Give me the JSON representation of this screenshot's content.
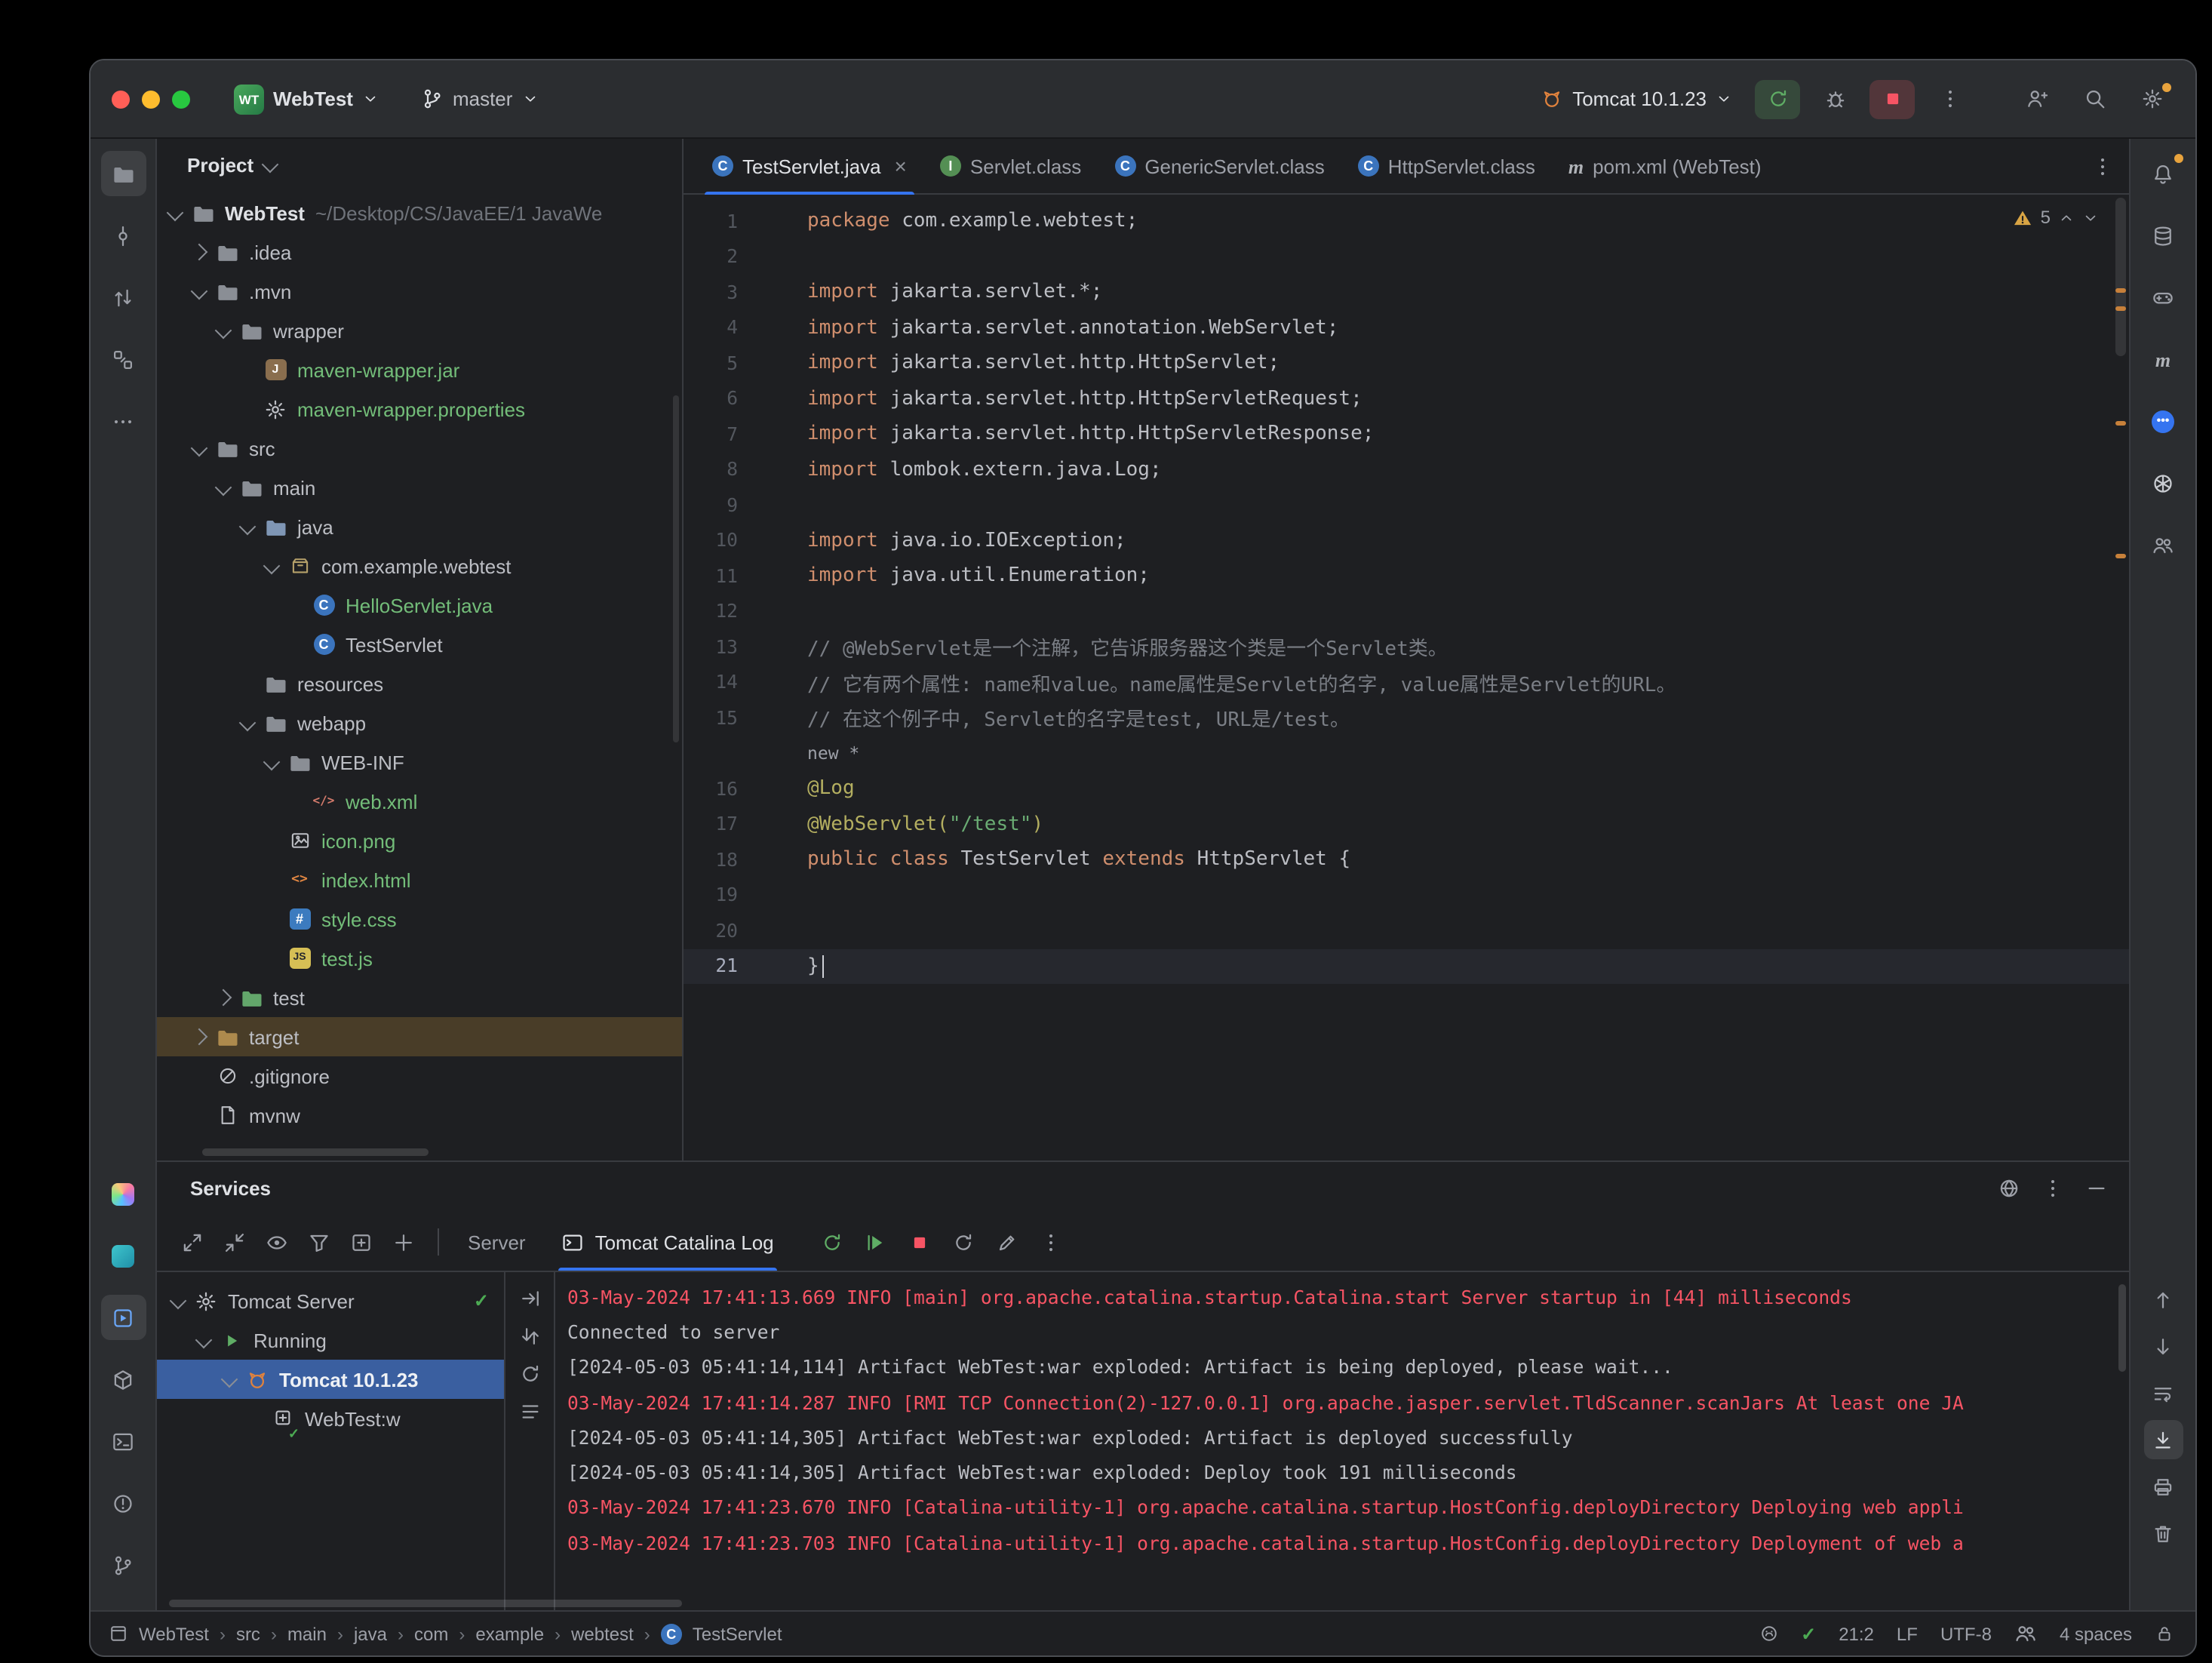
{
  "titlebar": {
    "project_logo": "WT",
    "project_name": "WebTest",
    "branch_name": "master",
    "run_config_name": "Tomcat 10.1.23",
    "action_icons": [
      "run-icon",
      "debug-icon",
      "stop-icon",
      "kebab-icon"
    ],
    "tool_icons": [
      "add-user-icon",
      "search-icon",
      "settings-icon"
    ]
  },
  "left_strip": {
    "top": [
      {
        "icon": "project-folder-icon",
        "selected": true
      },
      {
        "icon": "commit-icon"
      },
      {
        "icon": "pull-requests-icon"
      },
      {
        "icon": "structure-icon"
      },
      {
        "icon": "more-tools-icon"
      }
    ],
    "bottom": [
      {
        "icon": "ai-assistant-icon"
      },
      {
        "icon": "code-with-me-icon"
      },
      {
        "icon": "services-icon",
        "selected": true
      },
      {
        "icon": "packages-icon"
      },
      {
        "icon": "terminal-icon"
      },
      {
        "icon": "problems-icon"
      },
      {
        "icon": "vcs-icon"
      }
    ]
  },
  "right_strip": {
    "top": [
      {
        "icon": "notifications-icon",
        "badge": true
      },
      {
        "icon": "database-icon"
      },
      {
        "icon": "gamepad-icon"
      },
      {
        "icon": "maven-icon"
      },
      {
        "icon": "chat-icon"
      },
      {
        "icon": "openai-icon"
      },
      {
        "icon": "contacts-icon"
      }
    ],
    "console_actions": [
      {
        "icon": "arrow-up-icon"
      },
      {
        "icon": "arrow-down-icon"
      },
      {
        "icon": "softwrap-icon"
      },
      {
        "icon": "scroll-end-icon",
        "selected": true
      },
      {
        "icon": "printer-icon"
      },
      {
        "icon": "trash-icon"
      }
    ]
  },
  "project_panel": {
    "title": "Project",
    "tree": [
      {
        "label": "WebTest",
        "suffix": "~/Desktop/CS/JavaEE/1 JavaWe",
        "level": 0,
        "chevron": "open",
        "icon": "folder-icon",
        "bold": true
      },
      {
        "label": ".idea",
        "level": 1,
        "chevron": "closed",
        "icon": "folder-icon"
      },
      {
        "label": ".mvn",
        "level": 1,
        "chevron": "open",
        "icon": "folder-icon"
      },
      {
        "label": "wrapper",
        "level": 2,
        "chevron": "open",
        "icon": "folder-icon"
      },
      {
        "label": "maven-wrapper.jar",
        "level": 3,
        "chevron": "none",
        "icon": "jar-icon",
        "color": "green"
      },
      {
        "label": "maven-wrapper.properties",
        "level": 3,
        "chevron": "none",
        "icon": "properties-icon",
        "color": "green"
      },
      {
        "label": "src",
        "level": 1,
        "chevron": "open",
        "icon": "folder-icon"
      },
      {
        "label": "main",
        "level": 2,
        "chevron": "open",
        "icon": "folder-icon"
      },
      {
        "label": "java",
        "level": 3,
        "chevron": "open",
        "icon": "folder-src-icon"
      },
      {
        "label": "com.example.webtest",
        "level": 4,
        "chevron": "open",
        "icon": "package-icon"
      },
      {
        "label": "HelloServlet.java",
        "level": 5,
        "chevron": "none",
        "icon": "class-icon",
        "color": "green"
      },
      {
        "label": "TestServlet",
        "level": 5,
        "chevron": "none",
        "icon": "class-icon"
      },
      {
        "label": "resources",
        "level": 3,
        "chevron": "none",
        "icon": "folder-res-icon"
      },
      {
        "label": "webapp",
        "level": 3,
        "chevron": "open",
        "icon": "folder-icon"
      },
      {
        "label": "WEB-INF",
        "level": 4,
        "chevron": "open",
        "icon": "folder-icon"
      },
      {
        "label": "web.xml",
        "level": 5,
        "chevron": "none",
        "icon": "xml-icon",
        "color": "green"
      },
      {
        "label": "icon.png",
        "level": 4,
        "chevron": "none",
        "icon": "image-icon",
        "color": "green"
      },
      {
        "label": "index.html",
        "level": 4,
        "chevron": "none",
        "icon": "html-icon",
        "color": "green"
      },
      {
        "label": "style.css",
        "level": 4,
        "chevron": "none",
        "icon": "css-icon",
        "color": "green"
      },
      {
        "label": "test.js",
        "level": 4,
        "chevron": "none",
        "icon": "js-icon",
        "color": "green"
      },
      {
        "label": "test",
        "level": 2,
        "chevron": "closed",
        "icon": "folder-test-icon"
      },
      {
        "label": "target",
        "level": 1,
        "chevron": "closed",
        "icon": "folder-excluded-icon",
        "selected": true
      },
      {
        "label": ".gitignore",
        "level": 1,
        "chevron": "none",
        "icon": "ignored-icon"
      },
      {
        "label": "mvnw",
        "level": 1,
        "chevron": "none",
        "icon": "file-icon"
      }
    ]
  },
  "editor": {
    "tabs": [
      {
        "label": "TestServlet.java",
        "icon": "class-icon",
        "active": true,
        "closable": true
      },
      {
        "label": "Servlet.class",
        "icon": "interface-icon"
      },
      {
        "label": "GenericServlet.class",
        "icon": "class-icon"
      },
      {
        "label": "HttpServlet.class",
        "icon": "class-icon"
      },
      {
        "label": "pom.xml (WebTest)",
        "icon": "maven-icon"
      }
    ],
    "inspections": {
      "warnings": "5"
    },
    "lines": [
      {
        "n": "1",
        "segs": [
          [
            "k",
            "package"
          ],
          [
            "p",
            " com.example.webtest;"
          ]
        ]
      },
      {
        "n": "2",
        "segs": []
      },
      {
        "n": "3",
        "segs": [
          [
            "k",
            "import"
          ],
          [
            "p",
            " jakarta.servlet.*;"
          ]
        ]
      },
      {
        "n": "4",
        "segs": [
          [
            "k",
            "import"
          ],
          [
            "p",
            " jakarta.servlet.annotation.WebServlet;"
          ]
        ]
      },
      {
        "n": "5",
        "segs": [
          [
            "k",
            "import"
          ],
          [
            "p",
            " jakarta.servlet.http.HttpServlet;"
          ]
        ]
      },
      {
        "n": "6",
        "segs": [
          [
            "k",
            "import"
          ],
          [
            "p",
            " jakarta.servlet.http.HttpServletRequest;"
          ]
        ]
      },
      {
        "n": "7",
        "segs": [
          [
            "k",
            "import"
          ],
          [
            "p",
            " jakarta.servlet.http.HttpServletResponse;"
          ]
        ]
      },
      {
        "n": "8",
        "segs": [
          [
            "k",
            "import"
          ],
          [
            "p",
            " lombok.extern.java.Log;"
          ]
        ]
      },
      {
        "n": "9",
        "segs": []
      },
      {
        "n": "10",
        "segs": [
          [
            "k",
            "import"
          ],
          [
            "p",
            " java.io.IOException;"
          ]
        ]
      },
      {
        "n": "11",
        "segs": [
          [
            "k",
            "import"
          ],
          [
            "p",
            " java.util.Enumeration;"
          ]
        ]
      },
      {
        "n": "12",
        "segs": []
      },
      {
        "n": "13",
        "segs": [
          [
            "c",
            "// @WebServlet是一个注解，它告诉服务器这个类是一个Servlet类。"
          ]
        ]
      },
      {
        "n": "14",
        "segs": [
          [
            "c",
            "// 它有两个属性: name和value。name属性是Servlet的名字, value属性是Servlet的URL。"
          ]
        ]
      },
      {
        "n": "15",
        "segs": [
          [
            "c",
            "// 在这个例子中, Servlet的名字是test, URL是/test。"
          ]
        ]
      },
      {
        "n": "",
        "hint": "new *"
      },
      {
        "n": "16",
        "segs": [
          [
            "a",
            "@Log"
          ]
        ]
      },
      {
        "n": "17",
        "segs": [
          [
            "a",
            "@WebServlet("
          ],
          [
            "s",
            "\"/test\""
          ],
          [
            "a",
            ")"
          ]
        ]
      },
      {
        "n": "18",
        "segs": [
          [
            "k",
            "public class "
          ],
          [
            "p",
            "TestServlet "
          ],
          [
            "k",
            "extends "
          ],
          [
            "p",
            "HttpServlet "
          ],
          [
            "p",
            "{"
          ]
        ]
      },
      {
        "n": "19",
        "segs": []
      },
      {
        "n": "20",
        "segs": []
      },
      {
        "n": "21",
        "segs": [
          [
            "p",
            "}"
          ]
        ],
        "caret": true
      }
    ]
  },
  "services": {
    "title": "Services",
    "header_actions": [
      "globe-icon",
      "kebab-icon",
      "hide-icon"
    ],
    "toolbar_icons_left": [
      "expand-icon",
      "collapse-icon",
      "eye-icon",
      "filter-icon",
      "add-tab-icon",
      "plus-icon"
    ],
    "toolbar_tabs": [
      {
        "label": "Server"
      },
      {
        "label": "Tomcat Catalina Log",
        "icon": "console-icon",
        "selected": true
      }
    ],
    "toolbar_actions": [
      "rerun-icon",
      "resume-icon",
      "stop-icon",
      "refresh-icon",
      "deploy-icon",
      "kebab-icon"
    ],
    "console_gutter_icons": [
      "goto-icon",
      "swap-icon",
      "refresh-icon",
      "list-icon"
    ],
    "tree": [
      {
        "label": "Tomcat Server",
        "level": 0,
        "chevron": "open",
        "icon": "server-icon",
        "check_right": true
      },
      {
        "label": "Running",
        "level": 1,
        "chevron": "open",
        "icon": "run-tri-icon"
      },
      {
        "label": "Tomcat 10.1.23",
        "level": 2,
        "chevron": "open",
        "icon": "tomcat-icon",
        "selected": true
      },
      {
        "label": "WebTest:w",
        "level": 3,
        "chevron": "none",
        "icon": "artifact-icon"
      }
    ],
    "console": [
      {
        "c": "red",
        "t": "03-May-2024 17:41:13.669 INFO [main] org.apache.catalina.startup.Catalina.start Server startup in [44] milliseconds"
      },
      {
        "c": "plain",
        "t": "Connected to server"
      },
      {
        "c": "plain",
        "t": "[2024-05-03 05:41:14,114] Artifact WebTest:war exploded: Artifact is being deployed, please wait..."
      },
      {
        "c": "red",
        "t": "03-May-2024 17:41:14.287 INFO [RMI TCP Connection(2)-127.0.0.1] org.apache.jasper.servlet.TldScanner.scanJars At least one JA"
      },
      {
        "c": "plain",
        "t": "[2024-05-03 05:41:14,305] Artifact WebTest:war exploded: Artifact is deployed successfully"
      },
      {
        "c": "plain",
        "t": "[2024-05-03 05:41:14,305] Artifact WebTest:war exploded: Deploy took 191 milliseconds"
      },
      {
        "c": "red",
        "t": "03-May-2024 17:41:23.670 INFO [Catalina-utility-1] org.apache.catalina.startup.HostConfig.deployDirectory Deploying web appli"
      },
      {
        "c": "red",
        "t": "03-May-2024 17:41:23.703 INFO [Catalina-utility-1] org.apache.catalina.startup.HostConfig.deployDirectory Deployment of web a"
      }
    ]
  },
  "status_bar": {
    "breadcrumbs": [
      "WebTest",
      "src",
      "main",
      "java",
      "com",
      "example",
      "webtest",
      "TestServlet"
    ],
    "caret_position": "21:2",
    "line_separator": "LF",
    "encoding": "UTF-8",
    "indent": "4 spaces"
  },
  "colors": {
    "accent_blue": "#3574f0",
    "error_red": "#f75464",
    "vcs_added_green": "#73bd79",
    "warning_orange": "#e8a33d",
    "selection_amber": "#b08639",
    "selection_blue": "#3a5fa0"
  }
}
